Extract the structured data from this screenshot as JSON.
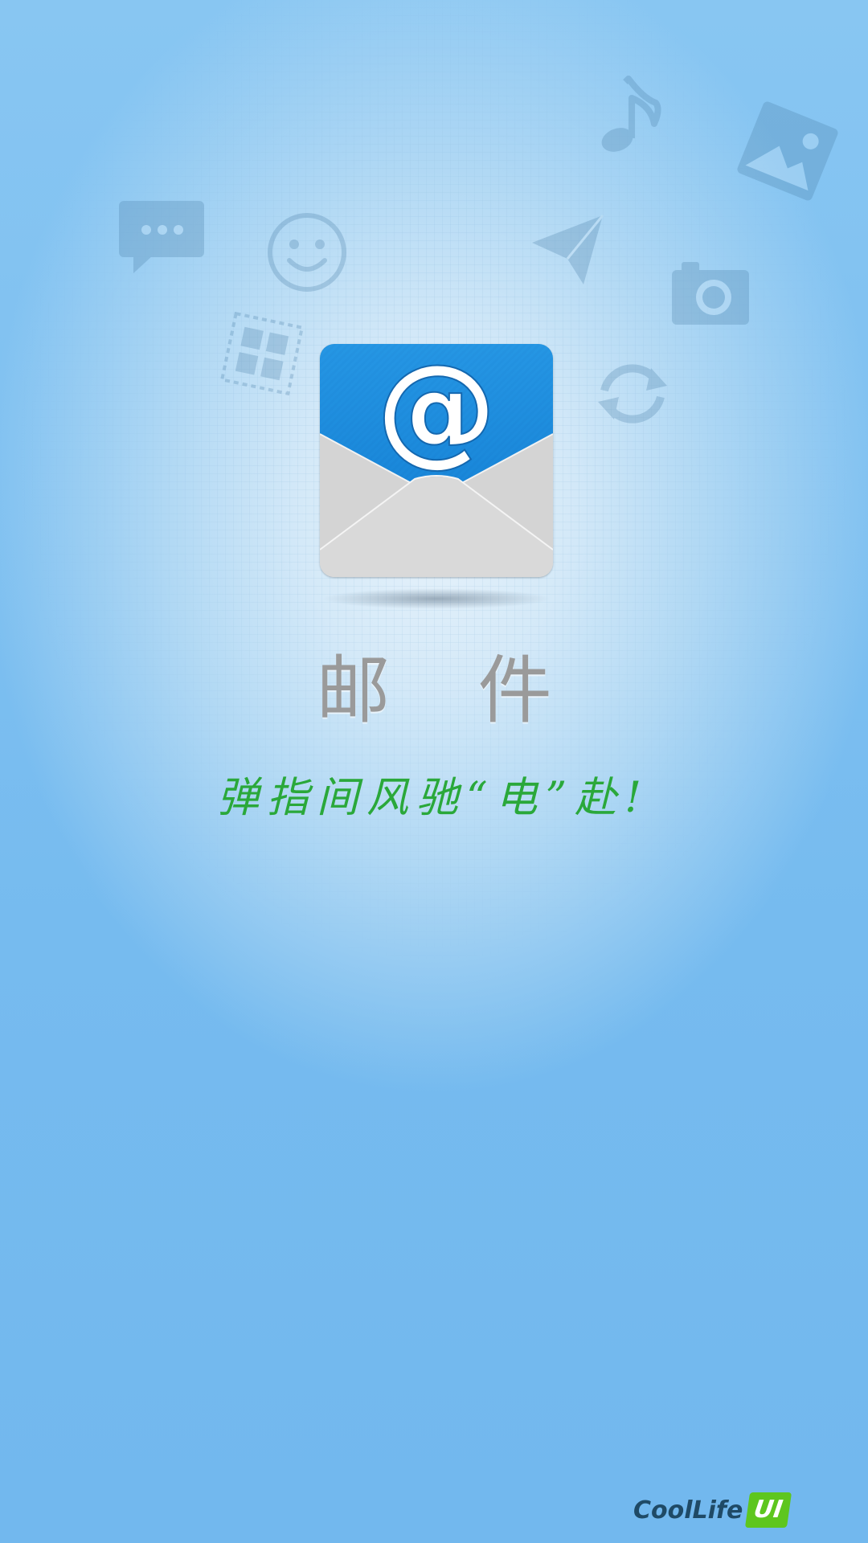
{
  "splash": {
    "app_name": "邮 件",
    "slogan": "弹指间风驰“电”赴!",
    "brand": {
      "name": "CoolLife",
      "badge": "UI"
    }
  },
  "icons": {
    "app_icon": "email-at-envelope-icon",
    "decorations": [
      "chat-bubble-icon",
      "smiley-icon",
      "music-note-icon",
      "send-paper-plane-icon",
      "photo-gallery-icon",
      "camera-icon",
      "app-grid-icon",
      "sync-icon"
    ]
  },
  "colors": {
    "background": "#7bbef0",
    "icon_blue": "#1a8fe0",
    "envelope_gray": "#d7d7d7",
    "app_name": "#9a9a9a",
    "slogan": "#2aa83a",
    "brand_text": "#1f4a66",
    "brand_badge": "#5ec61e"
  }
}
